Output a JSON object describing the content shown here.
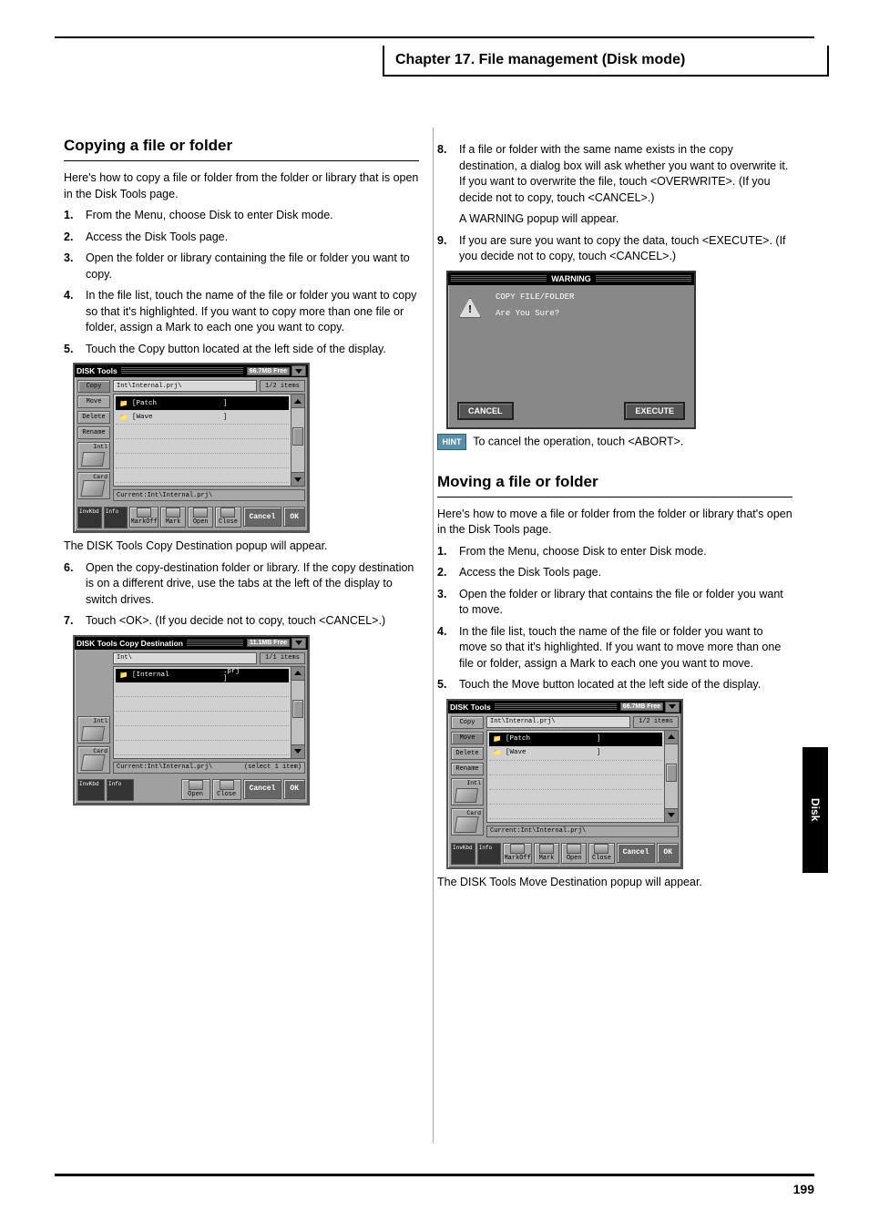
{
  "header": {
    "title_box": "Chapter 17. File management (Disk mode)"
  },
  "chapter_tab": "Disk",
  "page_number": "199",
  "left": {
    "section_title": "Copying a file or folder",
    "intro": "Here's how to copy a file or folder from the folder or library that is open in the Disk Tools page.",
    "steps": [
      "From the Menu, choose Disk to enter Disk mode.",
      "Access the Disk Tools page.",
      "Open the folder or library containing the file or folder you want to copy.",
      "In the file list, touch the name of the file or folder you want to copy so that it's highlighted. If you want to copy more than one file or folder, assign a Mark to each one you want to copy.",
      "Touch the Copy button located at the left side of the display."
    ],
    "fig1": {
      "title": "DISK Tools",
      "free": "66.7MB Free",
      "path": "Int\\Internal.prj\\",
      "items": "1/2 items",
      "rows": [
        {
          "name": "[Patch",
          "mark": "]",
          "sel": true
        },
        {
          "name": "[Wave",
          "mark": "]",
          "sel": false
        }
      ],
      "current": "Current:Int\\Internal.prj\\",
      "sidebar": [
        "Copy",
        "Move",
        "Delete",
        "Rename"
      ],
      "icons": [
        "Intl",
        "Card"
      ],
      "bottom_invkbd": "InvKbd",
      "bottom_info": "Info",
      "bottom_btns": [
        "MarkOff",
        "Mark",
        "Open",
        "Close"
      ],
      "cancel": "Cancel",
      "ok": "OK"
    },
    "after5": "The DISK Tools Copy Destination popup will appear.",
    "steps2": [
      "Open the copy-destination folder or library. If the copy destination is on a different drive, use the tabs at the left of the display to switch drives.",
      "Touch <OK>. (If you decide not to copy, touch <CANCEL>.)"
    ],
    "fig2": {
      "title": "DISK Tools Copy Destination",
      "free": "11.1MB Free",
      "path": "Int\\",
      "items": "1/1 items",
      "rows": [
        {
          "name": "[Internal",
          "mark": ".prj ]",
          "sel": true
        }
      ],
      "current": "Current:Int\\Internal.prj\\",
      "right_status": "(select 1 item)",
      "sidebar": [],
      "icons": [
        "Intl",
        "Card"
      ],
      "bottom_btns": [
        "Open",
        "Close"
      ],
      "cancel": "Cancel",
      "ok": "OK"
    }
  },
  "right": {
    "step8": "If a file or folder with the same name exists in the copy destination, a dialog box will ask whether you want to overwrite it. If you want to overwrite the file, touch <OVERWRITE>. (If you decide not to copy, touch <CANCEL>.)",
    "after8": "A WARNING popup will appear.",
    "step9": "If you are sure you want to copy the data, touch <EXECUTE>. (If you decide not to copy, touch <CANCEL>.)",
    "warn": {
      "title": "WARNING",
      "msg1": "COPY FILE/FOLDER",
      "msg2": "Are You Sure?",
      "cancel": "CANCEL",
      "execute": "EXECUTE"
    },
    "hint_label": "HINT",
    "hint_text": "To cancel the operation, touch <ABORT>.",
    "section2": "Moving a file or folder",
    "intro2": "Here's how to move a file or folder from the folder or library that's open in the Disk Tools page.",
    "steps3": [
      "From the Menu, choose Disk to enter Disk mode.",
      "Access the Disk Tools page.",
      "Open the folder or library that contains the file or folder you want to move.",
      "In the file list, touch the name of the file or folder you want to move so that it's highlighted. If you want to move more than one file or folder, assign a Mark to each one you want to move.",
      "Touch the Move button located at the left side of the display."
    ],
    "fig3": {
      "title": "DISK Tools",
      "free": "66.7MB Free",
      "path": "Int\\Internal.prj\\",
      "items": "1/2 items",
      "rows": [
        {
          "name": "[Patch",
          "mark": "]",
          "sel": true
        },
        {
          "name": "[Wave",
          "mark": "]",
          "sel": false
        }
      ],
      "current": "Current:Int\\Internal.prj\\",
      "sidebar": [
        "Copy",
        "Move",
        "Delete",
        "Rename"
      ],
      "icons": [
        "Intl",
        "Card"
      ],
      "bottom_btns": [
        "MarkOff",
        "Mark",
        "Open",
        "Close"
      ],
      "cancel": "Cancel",
      "ok": "OK"
    },
    "after5b": "The DISK Tools Move Destination popup will appear."
  }
}
